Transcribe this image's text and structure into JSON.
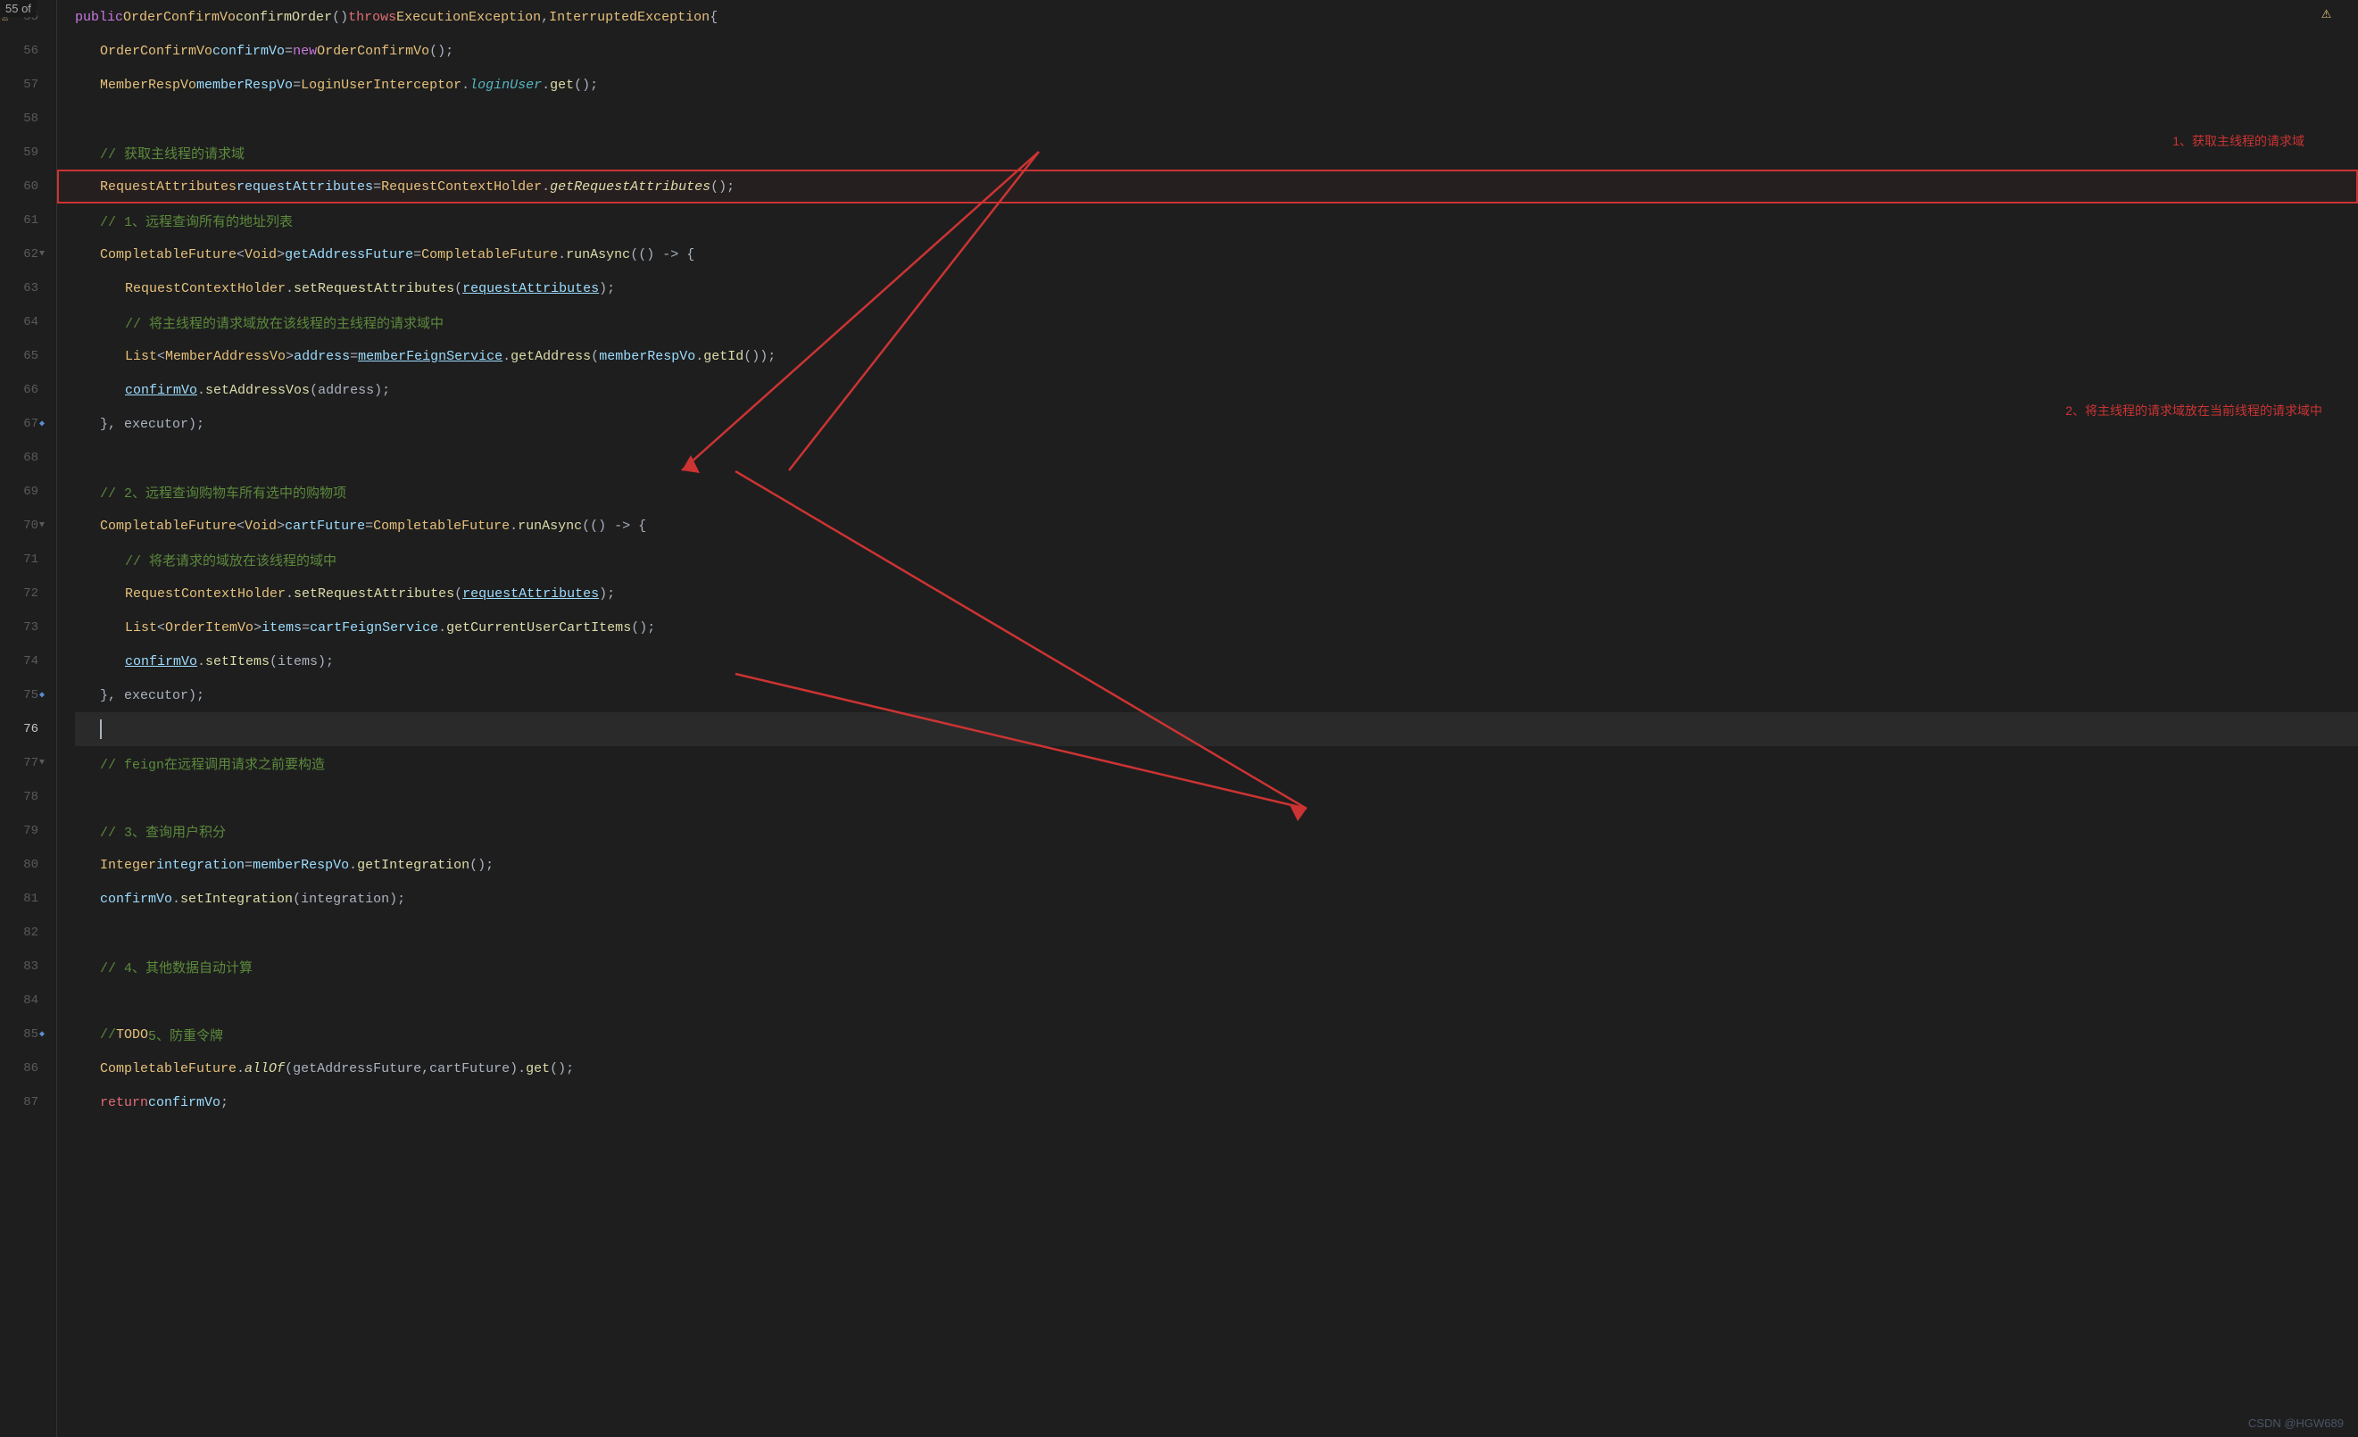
{
  "lines": [
    {
      "num": "55",
      "gutter_icon": "warning",
      "content": "public_confirmOrder"
    },
    {
      "num": "56",
      "gutter_icon": "",
      "content": "confirmVo_new"
    },
    {
      "num": "57",
      "gutter_icon": "",
      "content": "memberRespVo_login"
    },
    {
      "num": "58",
      "gutter_icon": "",
      "content": "empty"
    },
    {
      "num": "59",
      "gutter_icon": "",
      "content": "comment_59"
    },
    {
      "num": "60",
      "gutter_icon": "",
      "content": "requestAttributes_line",
      "highlight": true
    },
    {
      "num": "61",
      "gutter_icon": "",
      "content": "comment_61"
    },
    {
      "num": "62",
      "gutter_icon": "fold",
      "content": "getAddressFuture"
    },
    {
      "num": "63",
      "gutter_icon": "",
      "content": "setRequestAttributes_63"
    },
    {
      "num": "64",
      "gutter_icon": "",
      "content": "comment_64"
    },
    {
      "num": "65",
      "gutter_icon": "",
      "content": "address_line"
    },
    {
      "num": "66",
      "gutter_icon": "",
      "content": "confirmVo_setAddress"
    },
    {
      "num": "67",
      "gutter_icon": "",
      "content": "close_67"
    },
    {
      "num": "68",
      "gutter_icon": "",
      "content": "empty"
    },
    {
      "num": "69",
      "gutter_icon": "",
      "content": "comment_69"
    },
    {
      "num": "70",
      "gutter_icon": "fold",
      "content": "cartFuture"
    },
    {
      "num": "71",
      "gutter_icon": "",
      "content": "comment_71"
    },
    {
      "num": "72",
      "gutter_icon": "",
      "content": "setRequestAttributes_72"
    },
    {
      "num": "73",
      "gutter_icon": "",
      "content": "items_line"
    },
    {
      "num": "74",
      "gutter_icon": "",
      "content": "confirmVo_setItems"
    },
    {
      "num": "75",
      "gutter_icon": "bookmark",
      "content": "close_75"
    },
    {
      "num": "76",
      "gutter_icon": "",
      "content": "cursor_line",
      "active": true
    },
    {
      "num": "77",
      "gutter_icon": "fold",
      "content": "comment_77"
    },
    {
      "num": "78",
      "gutter_icon": "",
      "content": "empty"
    },
    {
      "num": "79",
      "gutter_icon": "",
      "content": "comment_79"
    },
    {
      "num": "80",
      "gutter_icon": "",
      "content": "integration"
    },
    {
      "num": "81",
      "gutter_icon": "",
      "content": "confirmVo_setIntegration"
    },
    {
      "num": "82",
      "gutter_icon": "",
      "content": "empty"
    },
    {
      "num": "83",
      "gutter_icon": "",
      "content": "comment_83"
    },
    {
      "num": "84",
      "gutter_icon": "",
      "content": "empty"
    },
    {
      "num": "85",
      "gutter_icon": "bookmark",
      "content": "comment_85"
    },
    {
      "num": "86",
      "gutter_icon": "",
      "content": "allOf"
    },
    {
      "num": "87",
      "gutter_icon": "",
      "content": "return_confirmVo"
    }
  ],
  "watermark": "CSDN @HGW689",
  "annotations": {
    "ann1_label": "1、获取主线程的请求域",
    "ann2_label": "2、将主线程的请求域放在当前线程的请求域中"
  }
}
